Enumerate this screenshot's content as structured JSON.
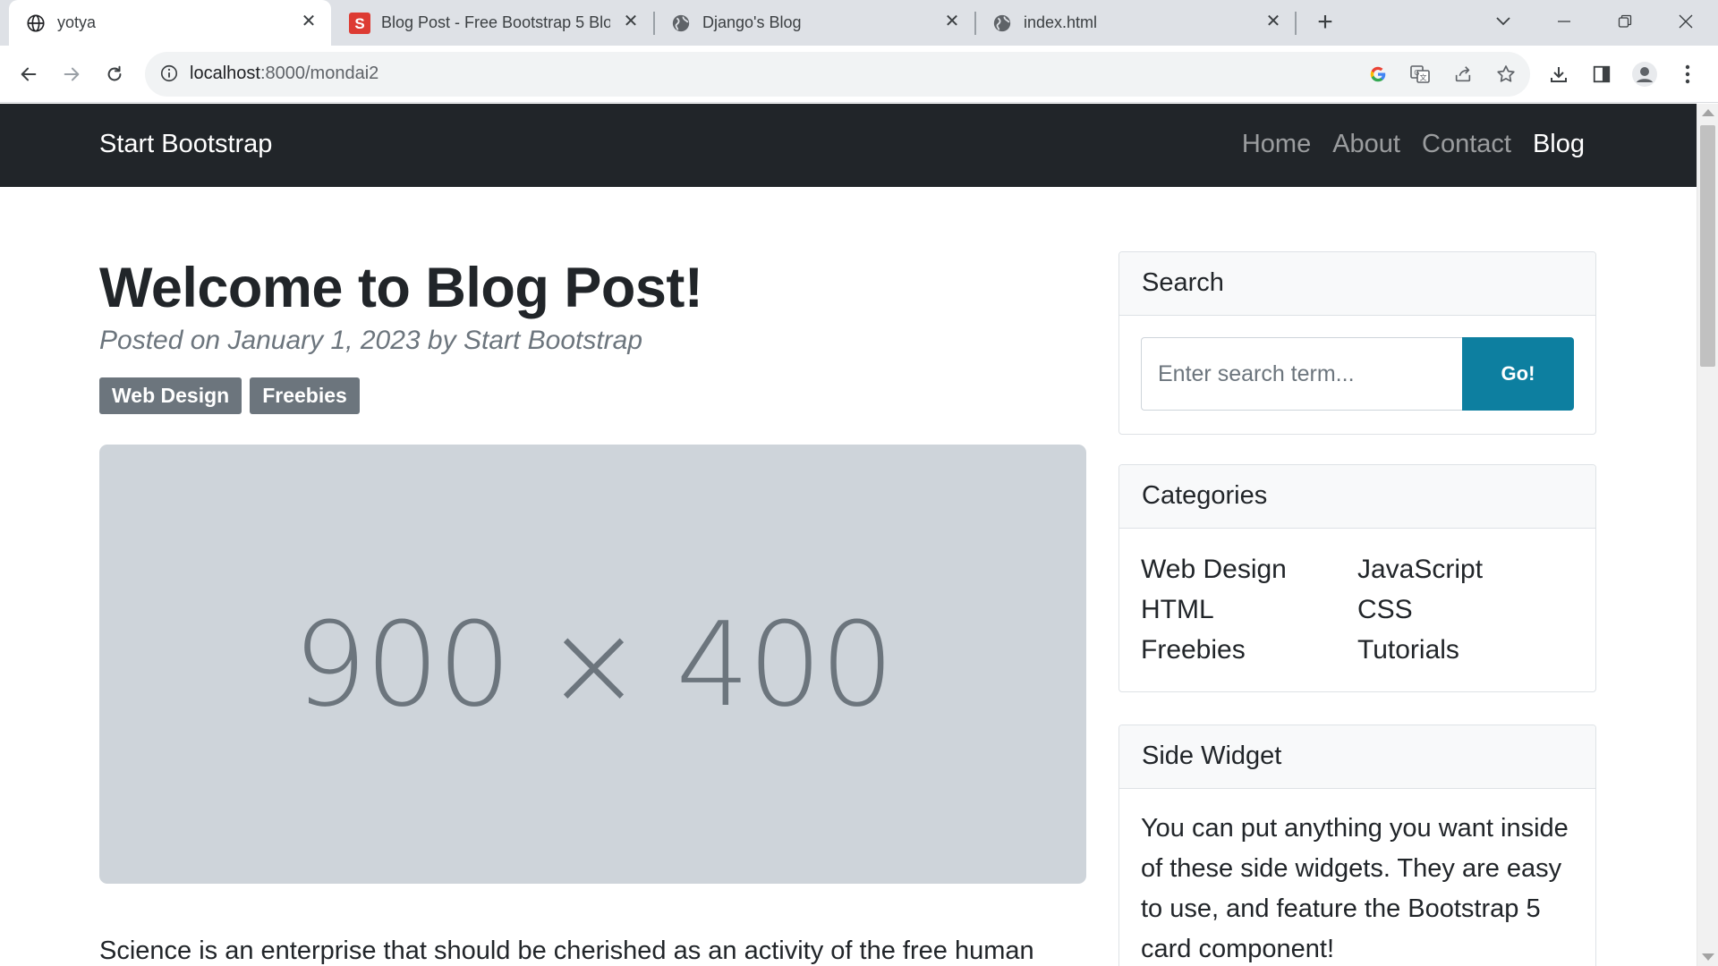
{
  "browser": {
    "tabs": [
      {
        "title": "yotya",
        "icon": "globe-icon",
        "active": true
      },
      {
        "title": "Blog Post - Free Bootstrap 5 Blog",
        "icon": "startbootstrap-s-icon",
        "active": false
      },
      {
        "title": "Django's Blog",
        "icon": "globe-icon",
        "active": false
      },
      {
        "title": "index.html",
        "icon": "globe-icon",
        "active": false
      }
    ],
    "url_host": "localhost",
    "url_rest": ":8000/mondai2"
  },
  "site": {
    "brand": "Start Bootstrap",
    "nav": [
      "Home",
      "About",
      "Contact",
      "Blog"
    ],
    "active_nav": "Blog"
  },
  "post": {
    "title": "Welcome to Blog Post!",
    "meta": "Posted on January 1, 2023 by Start Bootstrap",
    "tags": [
      "Web Design",
      "Freebies"
    ],
    "image_placeholder": "900 × 400",
    "body_first_line": "Science is an enterprise that should be cherished as an activity of the free human"
  },
  "sidebar": {
    "search": {
      "header": "Search",
      "placeholder": "Enter search term...",
      "button": "Go!"
    },
    "categories": {
      "header": "Categories",
      "col1": [
        "Web Design",
        "HTML",
        "Freebies"
      ],
      "col2": [
        "JavaScript",
        "CSS",
        "Tutorials"
      ]
    },
    "side_widget": {
      "header": "Side Widget",
      "text": "You can put anything you want inside of these side widgets. They are easy to use, and feature the Bootstrap 5 card component!"
    }
  },
  "colors": {
    "navbar_bg": "#212529",
    "badge_bg": "#6c757d",
    "go_button": "#0d7fa0",
    "image_bg": "#ced4da"
  }
}
